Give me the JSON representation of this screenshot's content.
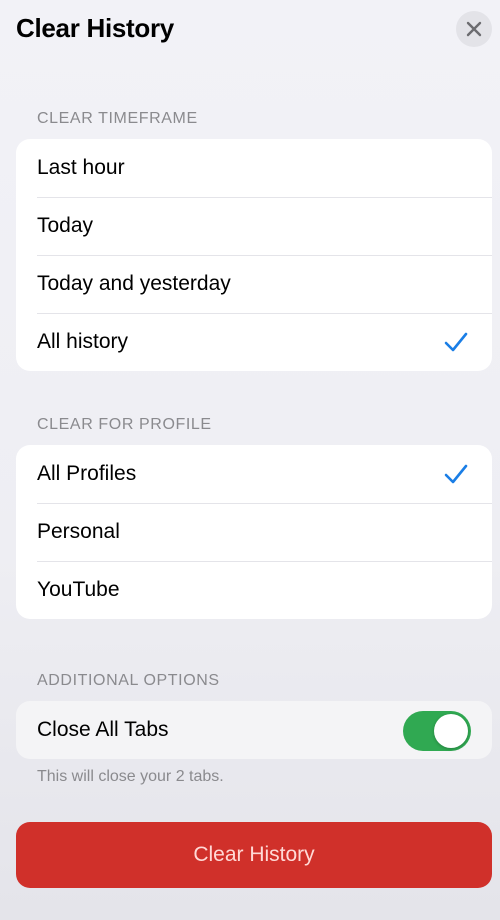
{
  "header": {
    "title": "Clear History",
    "close_icon": "close-icon"
  },
  "timeframe": {
    "label": "CLEAR TIMEFRAME",
    "options": [
      "Last hour",
      "Today",
      "Today and yesterday",
      "All history"
    ],
    "selected": "All history"
  },
  "profile": {
    "label": "CLEAR FOR PROFILE",
    "options": [
      "All Profiles",
      "Personal",
      "YouTube"
    ],
    "selected": "All Profiles"
  },
  "additional": {
    "label": "ADDITIONAL OPTIONS",
    "close_tabs_label": "Close All Tabs",
    "close_tabs_on": true,
    "footnote": "This will close your 2 tabs."
  },
  "action": {
    "clear_label": "Clear History"
  },
  "colors": {
    "accent_check": "#1a7ee6",
    "toggle_on": "#30a952",
    "button_red": "#d0302a"
  }
}
